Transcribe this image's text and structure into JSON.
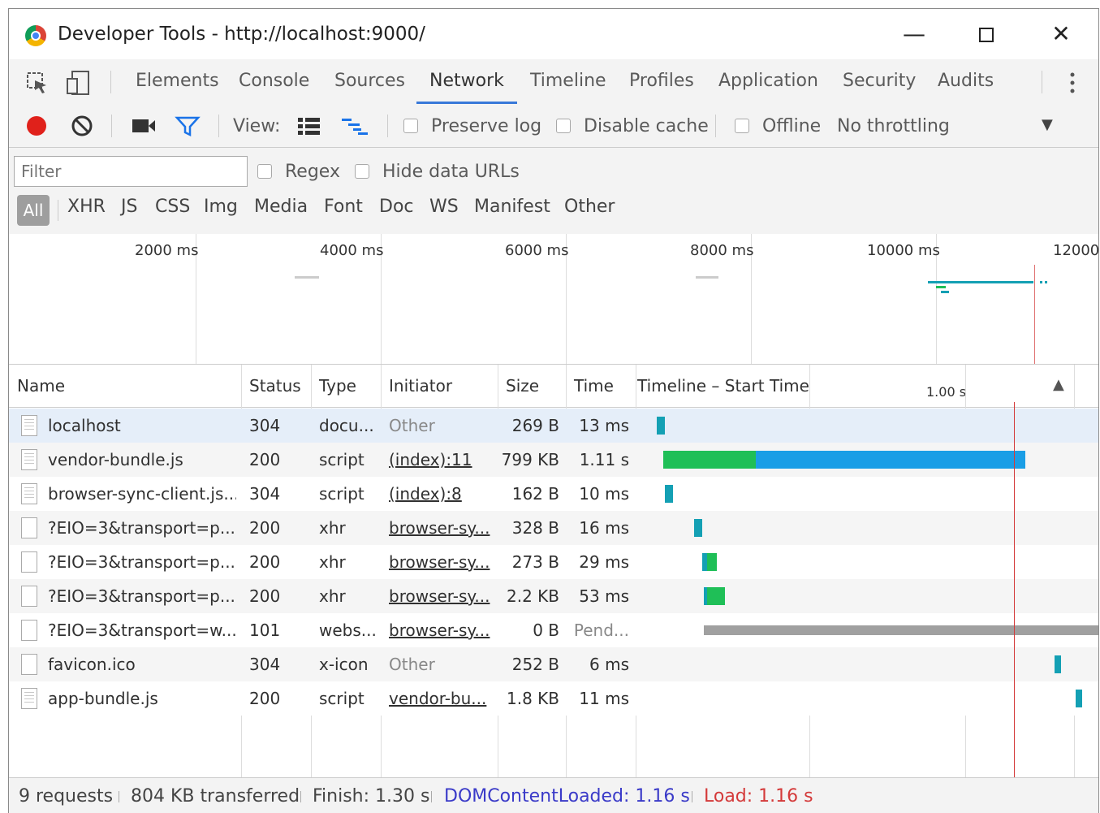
{
  "window": {
    "title": "Developer Tools - http://localhost:9000/"
  },
  "tabs": [
    "Elements",
    "Console",
    "Sources",
    "Network",
    "Timeline",
    "Profiles",
    "Application",
    "Security",
    "Audits"
  ],
  "active_tab": "Network",
  "toolbar": {
    "view_label": "View:",
    "preserve_log": "Preserve log",
    "disable_cache": "Disable cache",
    "offline": "Offline",
    "throttling": "No throttling"
  },
  "filter": {
    "placeholder": "Filter",
    "regex": "Regex",
    "hide_data_urls": "Hide data URLs",
    "types": [
      "All",
      "XHR",
      "JS",
      "CSS",
      "Img",
      "Media",
      "Font",
      "Doc",
      "WS",
      "Manifest",
      "Other"
    ]
  },
  "overview": {
    "ticks": [
      "2000 ms",
      "4000 ms",
      "6000 ms",
      "8000 ms",
      "10000 ms",
      "12000"
    ]
  },
  "columns": {
    "name": "Name",
    "status": "Status",
    "type": "Type",
    "initiator": "Initiator",
    "size": "Size",
    "time": "Time",
    "timeline": "Timeline – Start Time",
    "scale": "1.00 s"
  },
  "requests": [
    {
      "name": "localhost",
      "status": "304",
      "type": "docu...",
      "initiator": "Other",
      "initiator_link": false,
      "size": "269 B",
      "time": "13 ms",
      "icon": "doc"
    },
    {
      "name": "vendor-bundle.js",
      "status": "200",
      "type": "script",
      "initiator": "(index):11",
      "initiator_link": true,
      "size": "799 KB",
      "time": "1.11 s",
      "icon": "doc"
    },
    {
      "name": "browser-sync-client.js...",
      "status": "304",
      "type": "script",
      "initiator": "(index):8",
      "initiator_link": true,
      "size": "162 B",
      "time": "10 ms",
      "icon": "doc"
    },
    {
      "name": "?EIO=3&transport=p...",
      "status": "200",
      "type": "xhr",
      "initiator": "browser-sy...",
      "initiator_link": true,
      "size": "328 B",
      "time": "16 ms",
      "icon": "blank"
    },
    {
      "name": "?EIO=3&transport=p...",
      "status": "200",
      "type": "xhr",
      "initiator": "browser-sy...",
      "initiator_link": true,
      "size": "273 B",
      "time": "29 ms",
      "icon": "blank"
    },
    {
      "name": "?EIO=3&transport=p...",
      "status": "200",
      "type": "xhr",
      "initiator": "browser-sy...",
      "initiator_link": true,
      "size": "2.2 KB",
      "time": "53 ms",
      "icon": "blank"
    },
    {
      "name": "?EIO=3&transport=w...",
      "status": "101",
      "type": "webs...",
      "initiator": "browser-sy...",
      "initiator_link": true,
      "size": "0 B",
      "time": "Pend...",
      "icon": "blank"
    },
    {
      "name": "favicon.ico",
      "status": "304",
      "type": "x-icon",
      "initiator": "Other",
      "initiator_link": false,
      "size": "252 B",
      "time": "6 ms",
      "icon": "blank"
    },
    {
      "name": "app-bundle.js",
      "status": "200",
      "type": "script",
      "initiator": "vendor-bu...",
      "initiator_link": true,
      "size": "1.8 KB",
      "time": "11 ms",
      "icon": "doc"
    }
  ],
  "status": {
    "requests": "9 requests",
    "transferred": "804 KB transferred",
    "finish": "Finish: 1.30 s",
    "dcl": "DOMContentLoaded: 1.16 s",
    "load": "Load: 1.16 s"
  },
  "colors": {
    "accent": "#3879d9",
    "dcl": "#3a3ac8",
    "load": "#d43a3a",
    "waiting": "#1fbf57",
    "download": "#1a9ee6",
    "teal": "#14a0b4",
    "pending": "#a0a0a0"
  }
}
